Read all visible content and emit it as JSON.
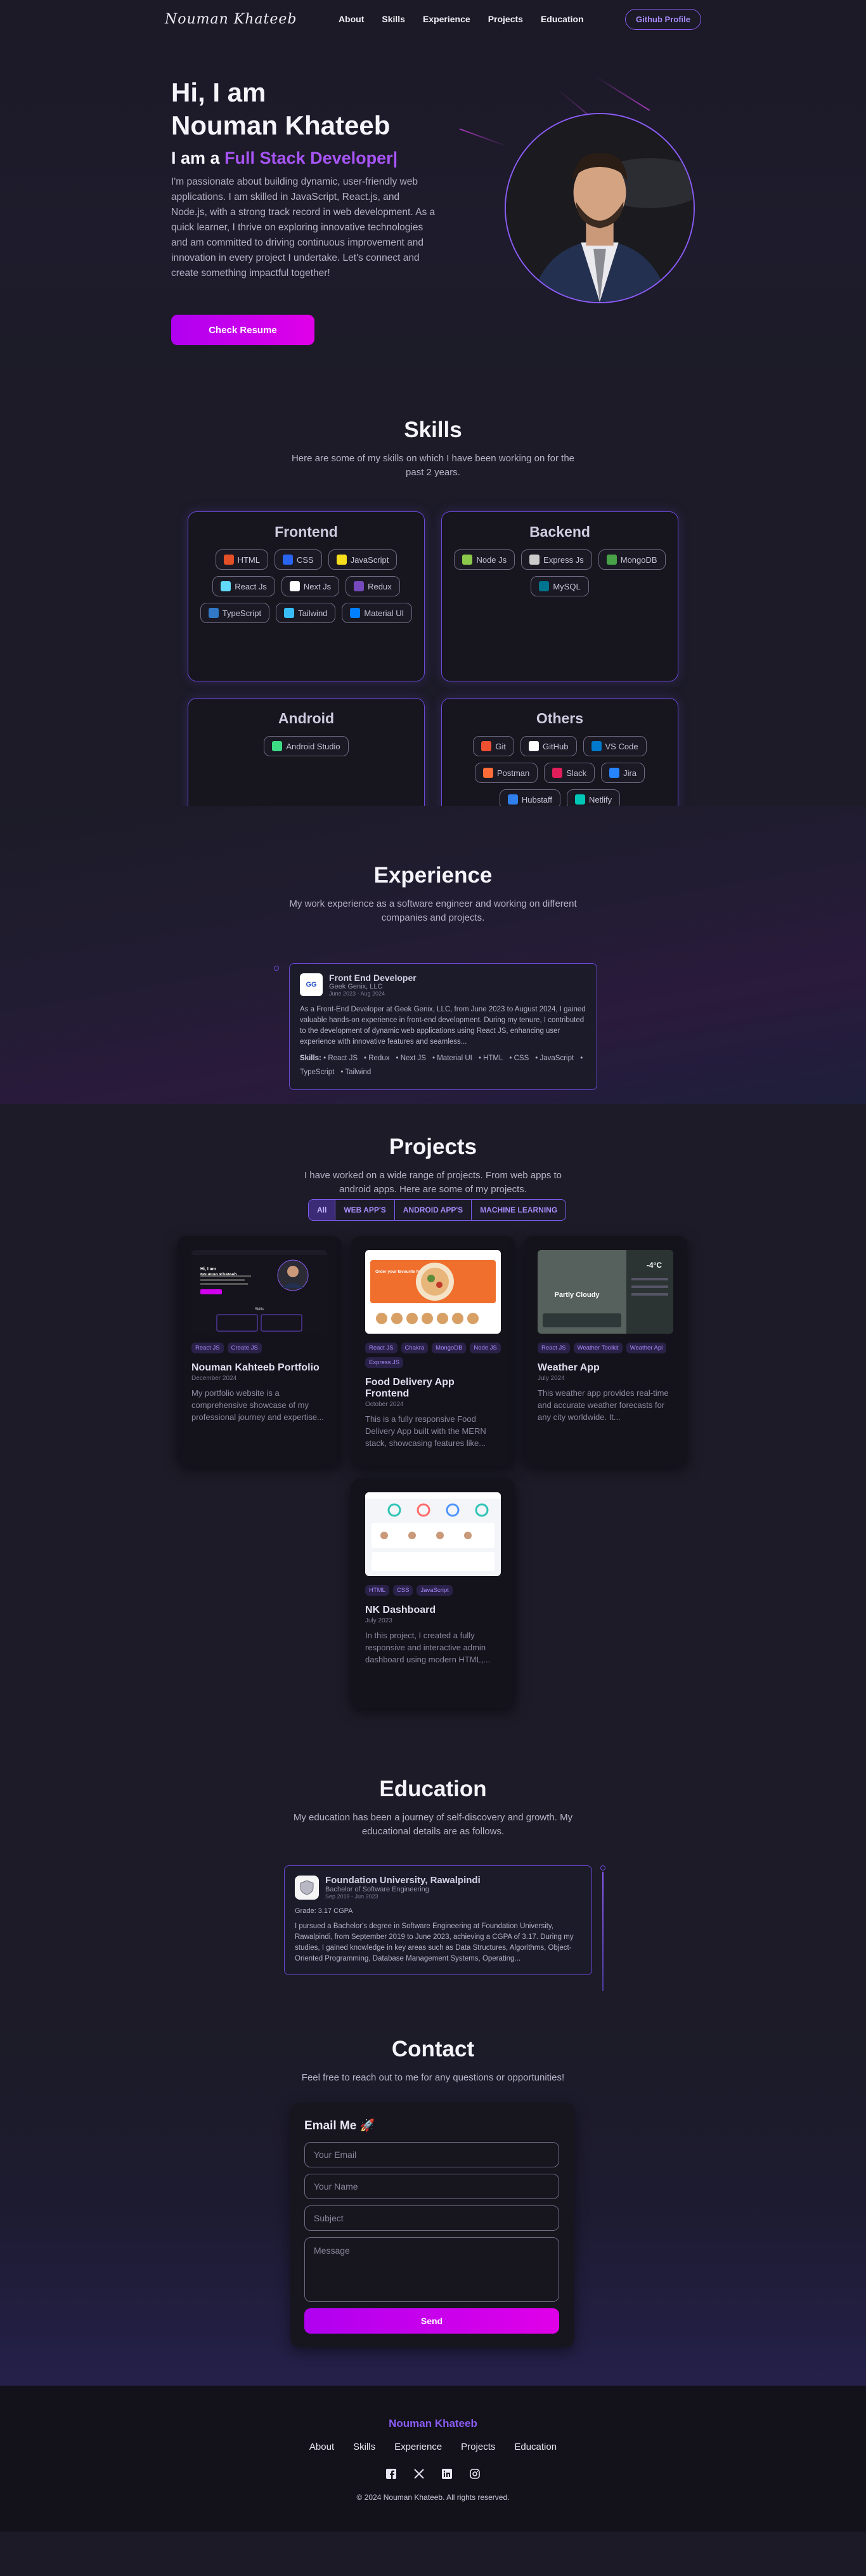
{
  "nav": {
    "logo": "Nouman Khateeb",
    "links": [
      "About",
      "Skills",
      "Experience",
      "Projects",
      "Education"
    ],
    "github_button": "Github Profile"
  },
  "hero": {
    "greeting": "Hi, I am",
    "name": "Nouman Khateeb",
    "role_prefix": "I am a",
    "role": "Full Stack Developer|",
    "bio": "I'm passionate about building dynamic, user-friendly web applications. I am skilled in JavaScript, React.js, and Node.js, with a strong track record in web development. As a quick learner, I thrive on exploring innovative technologies and am committed to driving continuous improvement and innovation in every project I undertake. Let's connect and create something impactful together!",
    "resume_button": "Check Resume"
  },
  "skills": {
    "title": "Skills",
    "subtitle": "Here are some of my skills on which I have been working on for the past 2 years.",
    "groups": [
      {
        "title": "Frontend",
        "items": [
          {
            "label": "HTML",
            "icon": "html-icon",
            "color": "#e34f26"
          },
          {
            "label": "CSS",
            "icon": "css-icon",
            "color": "#2965f1"
          },
          {
            "label": "JavaScript",
            "icon": "javascript-icon",
            "color": "#f7df1e"
          },
          {
            "label": "React Js",
            "icon": "react-icon",
            "color": "#61dafb"
          },
          {
            "label": "Next Js",
            "icon": "nextjs-icon",
            "color": "#ffffff"
          },
          {
            "label": "Redux",
            "icon": "redux-icon",
            "color": "#764abc"
          },
          {
            "label": "TypeScript",
            "icon": "typescript-icon",
            "color": "#3178c6"
          },
          {
            "label": "Tailwind",
            "icon": "tailwind-icon",
            "color": "#38bdf8"
          },
          {
            "label": "Material UI",
            "icon": "material-ui-icon",
            "color": "#007fff"
          }
        ]
      },
      {
        "title": "Backend",
        "items": [
          {
            "label": "Node Js",
            "icon": "nodejs-icon",
            "color": "#8cc84b"
          },
          {
            "label": "Express Js",
            "icon": "expressjs-icon",
            "color": "#cccccc"
          },
          {
            "label": "MongoDB",
            "icon": "mongodb-icon",
            "color": "#47a248"
          },
          {
            "label": "MySQL",
            "icon": "mysql-icon",
            "color": "#00758f"
          }
        ]
      },
      {
        "title": "Android",
        "items": [
          {
            "label": "Android Studio",
            "icon": "android-studio-icon",
            "color": "#3ddc84"
          }
        ]
      },
      {
        "title": "Others",
        "items": [
          {
            "label": "Git",
            "icon": "git-icon",
            "color": "#f05032"
          },
          {
            "label": "GitHub",
            "icon": "github-icon",
            "color": "#ffffff"
          },
          {
            "label": "VS Code",
            "icon": "vscode-icon",
            "color": "#007acc"
          },
          {
            "label": "Postman",
            "icon": "postman-icon",
            "color": "#ff6c37"
          },
          {
            "label": "Slack",
            "icon": "slack-icon",
            "color": "#e01e5a"
          },
          {
            "label": "Jira",
            "icon": "jira-icon",
            "color": "#2684ff"
          },
          {
            "label": "Hubstaff",
            "icon": "hubstaff-icon",
            "color": "#2f80ed"
          },
          {
            "label": "Netlify",
            "icon": "netlify-icon",
            "color": "#00c7b7"
          }
        ]
      }
    ]
  },
  "experience": {
    "title": "Experience",
    "subtitle": "My work experience as a software engineer and working on different companies and projects.",
    "items": [
      {
        "logo_text": "GG",
        "role": "Front End Developer",
        "company": "Geek Genix, LLC",
        "date": "June 2023 - Aug 2024",
        "description": "As a Front-End Developer at Geek Genix, LLC, from June 2023 to August 2024, I gained valuable hands-on experience in front-end development. During my tenure, I contributed to the development of dynamic web applications using React JS, enhancing user experience with innovative features and seamless...",
        "skills_label": "Skills:",
        "skills": [
          "React JS",
          "Redux",
          "Next JS",
          "Material UI",
          "HTML",
          "CSS",
          "JavaScript",
          "TypeScript",
          "Tailwind"
        ]
      }
    ]
  },
  "projects": {
    "title": "Projects",
    "subtitle": "I have worked on a wide range of projects. From web apps to android apps. Here are some of my projects.",
    "filters": [
      "All",
      "WEB APP'S",
      "ANDROID APP'S",
      "MACHINE LEARNING"
    ],
    "active_filter": "All",
    "cards": [
      {
        "title": "Nouman Kahteeb Portfolio",
        "date": "December 2024",
        "tags": [
          "React JS",
          "Create JS"
        ],
        "description": "My portfolio website is a comprehensive showcase of my professional journey and expertise...",
        "thumb": "portfolio",
        "thumb_heading": "Hi, I am\nNouman Khateeb",
        "thumb_section": "Skills"
      },
      {
        "title": "Food Delivery App Frontend",
        "date": "October 2024",
        "tags": [
          "React JS",
          "Chakra",
          "MongoDB",
          "Node JS",
          "Express JS"
        ],
        "description": "This is a fully responsive Food Delivery App built with the MERN stack, showcasing features like...",
        "thumb": "food",
        "thumb_heading": "Order your favourite food here"
      },
      {
        "title": "Weather App",
        "date": "July 2024",
        "tags": [
          "React JS",
          "Weather Toolkit",
          "Weather Api"
        ],
        "description": "This weather app provides real-time and accurate weather forecasts for any city worldwide. It...",
        "thumb": "weather",
        "thumb_heading": "Partly Cloudy",
        "thumb_temp": "-4°C"
      },
      {
        "title": "NK Dashboard",
        "date": "July 2023",
        "tags": [
          "HTML",
          "CSS",
          "JavaScript"
        ],
        "description": "In this project, I created a fully responsive and interactive admin dashboard using modern HTML,...",
        "thumb": "dashboard"
      }
    ]
  },
  "education": {
    "title": "Education",
    "subtitle": "My education has been a journey of self-discovery and growth. My educational details are as follows.",
    "items": [
      {
        "school": "Foundation University, Rawalpindi",
        "degree": "Bachelor of Software Engineering",
        "date": "Sep 2019 - Jun 2023",
        "grade": "Grade: 3.17 CGPA",
        "description": "I pursued a Bachelor's degree in Software Engineering at Foundation University, Rawalpindi, from September 2019 to June 2023, achieving a CGPA of 3.17. During my studies, I gained knowledge in key areas such as Data Structures, Algorithms, Object-Oriented Programming, Database Management Systems, Operating..."
      }
    ]
  },
  "contact": {
    "title": "Contact",
    "subtitle": "Feel free to reach out to me for any questions or opportunities!",
    "form_title": "Email Me 🚀",
    "email_placeholder": "Your Email",
    "name_placeholder": "Your Name",
    "subject_placeholder": "Subject",
    "message_placeholder": "Message",
    "send_button": "Send"
  },
  "footer": {
    "name": "Nouman Khateeb",
    "links": [
      "About",
      "Skills",
      "Experience",
      "Projects",
      "Education"
    ],
    "socials": [
      "facebook-icon",
      "x-twitter-icon",
      "linkedin-icon",
      "instagram-icon"
    ],
    "copyright": "© 2024 Nouman Khateeb. All rights reserved."
  },
  "colors": {
    "accent": "#8b5cf6",
    "magenta": "#d100ee",
    "background": "#1b1a26"
  }
}
